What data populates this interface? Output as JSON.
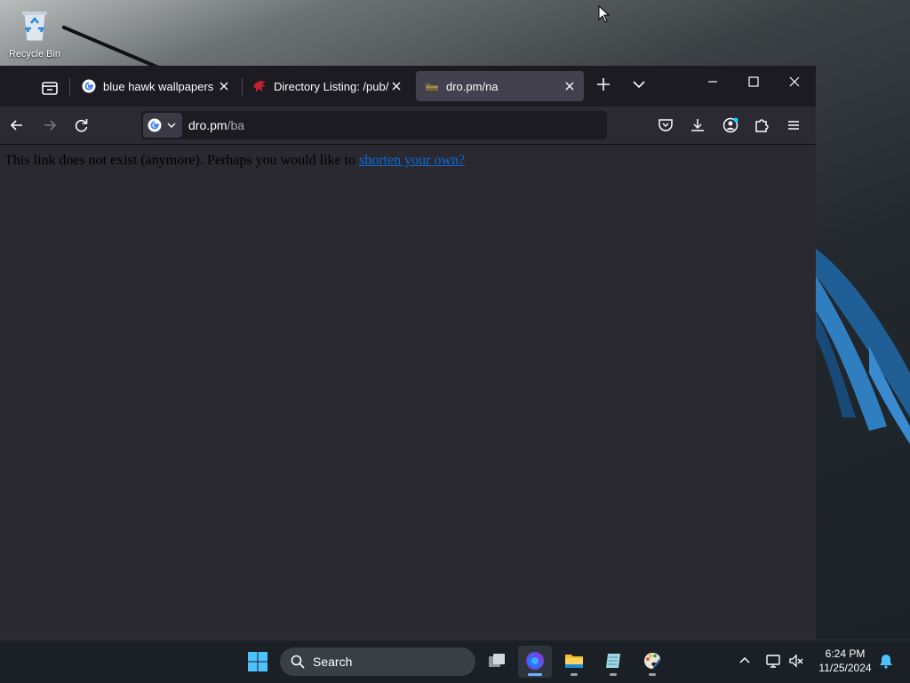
{
  "desktop": {
    "recycle_bin_label": "Recycle Bin"
  },
  "browser": {
    "tabs": [
      {
        "title": "blue hawk wallpapers - Google",
        "favicon": "google-icon",
        "active": false
      },
      {
        "title": "Directory Listing: /pub/firefox",
        "favicon": "ftp-dragon-icon",
        "active": false
      },
      {
        "title": "dro.pm/na",
        "favicon": "dro-pm-icon",
        "active": true
      }
    ],
    "url_host": "dro.pm",
    "url_path": "/ba",
    "search_engine": "google-icon",
    "page_message": "This link does not exist (anymore). Perhaps you would like to ",
    "page_link": "shorten your own?"
  },
  "taskbar": {
    "search_label": "Search",
    "time": "6:24 PM",
    "date": "11/25/2024"
  },
  "colors": {
    "accent": "#0b6bd6",
    "tab_active": "#42414d",
    "content_bg": "#2a2931"
  }
}
